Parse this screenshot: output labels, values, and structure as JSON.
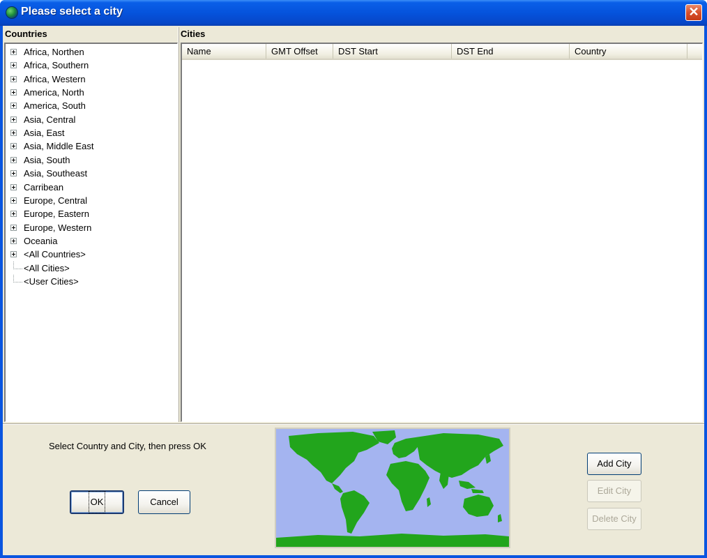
{
  "window": {
    "title": "Please select a city",
    "close_symbol": "✕"
  },
  "countries": {
    "label": "Countries",
    "items": [
      {
        "label": "Africa, Northen",
        "expandable": true
      },
      {
        "label": "Africa, Southern",
        "expandable": true
      },
      {
        "label": "Africa, Western",
        "expandable": true
      },
      {
        "label": "America, North",
        "expandable": true
      },
      {
        "label": "America, South",
        "expandable": true
      },
      {
        "label": "Asia, Central",
        "expandable": true
      },
      {
        "label": "Asia, East",
        "expandable": true
      },
      {
        "label": "Asia, Middle East",
        "expandable": true
      },
      {
        "label": "Asia, South",
        "expandable": true
      },
      {
        "label": "Asia, Southeast",
        "expandable": true
      },
      {
        "label": "Carribean",
        "expandable": true
      },
      {
        "label": "Europe, Central",
        "expandable": true
      },
      {
        "label": "Europe, Eastern",
        "expandable": true
      },
      {
        "label": "Europe, Western",
        "expandable": true
      },
      {
        "label": "Oceania",
        "expandable": true
      },
      {
        "label": "<All Countries>",
        "expandable": true
      },
      {
        "label": "<All Cities>",
        "expandable": false
      },
      {
        "label": "<User Cities>",
        "expandable": false
      }
    ]
  },
  "cities": {
    "label": "Cities",
    "columns": [
      "Name",
      "GMT Offset",
      "DST Start",
      "DST End",
      "Country"
    ],
    "rows": []
  },
  "footer": {
    "instruction": "Select Country and City, then press OK",
    "ok_label": "OK",
    "cancel_label": "Cancel",
    "add_city_label": "Add City",
    "edit_city_label": "Edit City",
    "delete_city_label": "Delete City"
  },
  "map": {
    "icon": "world-map",
    "ocean_color": "#a4b4f0",
    "land_color": "#22a51c"
  }
}
